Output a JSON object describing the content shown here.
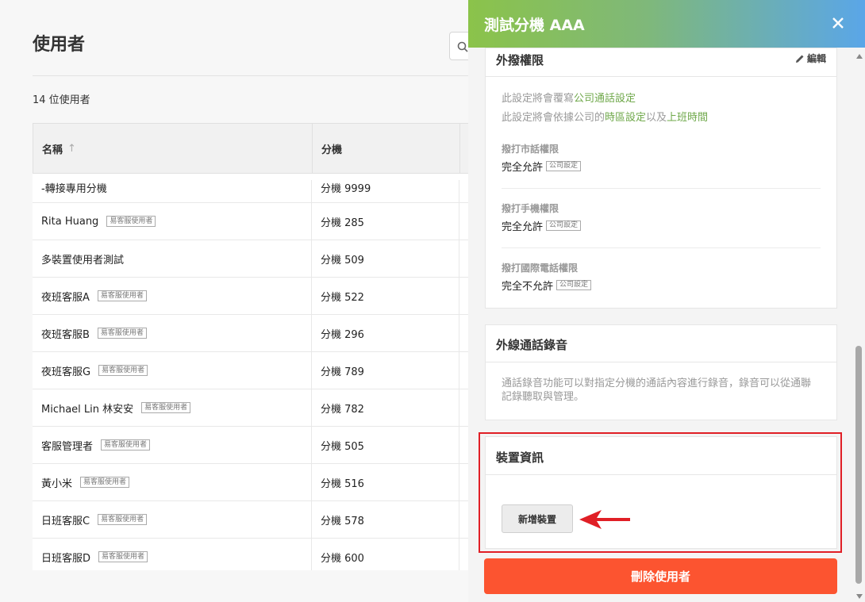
{
  "page": {
    "title": "使用者",
    "user_count": "14 位使用者"
  },
  "table": {
    "columns": [
      "名稱",
      "分機"
    ],
    "sort_indicator": "↑",
    "rows": [
      {
        "name": "-轉接專用分機",
        "tag": "",
        "ext": "分機 9999"
      },
      {
        "name": "Rita Huang",
        "tag": "易客服使用者",
        "ext": "分機 285"
      },
      {
        "name": "多裝置使用者測試",
        "tag": "",
        "ext": "分機 509"
      },
      {
        "name": "夜班客服A",
        "tag": "易客服使用者",
        "ext": "分機 522"
      },
      {
        "name": "夜班客服B",
        "tag": "易客服使用者",
        "ext": "分機 296"
      },
      {
        "name": "夜班客服G",
        "tag": "易客服使用者",
        "ext": "分機 789"
      },
      {
        "name": "Michael Lin 林安安",
        "tag": "易客服使用者",
        "ext": "分機 782"
      },
      {
        "name": "客服管理者",
        "tag": "易客服使用者",
        "ext": "分機 505"
      },
      {
        "name": "黃小米",
        "tag": "易客服使用者",
        "ext": "分機 516"
      },
      {
        "name": "日班客服C",
        "tag": "易客服使用者",
        "ext": "分機 578"
      },
      {
        "name": "日班客服D",
        "tag": "易客服使用者",
        "ext": "分機 600"
      }
    ]
  },
  "drawer": {
    "title": "測試分機 AAA",
    "close_icon": "close-icon",
    "outbound": {
      "title": "外撥權限",
      "edit_label": "編輯",
      "note1_prefix": "此設定將會覆寫",
      "note1_link": "公司通話設定",
      "note2_prefix": "此設定將會依據公司的",
      "note2_link1": "時區設定",
      "note2_mid": "以及",
      "note2_link2": "上班時間",
      "permissions": [
        {
          "label": "撥打市話權限",
          "value": "完全允許",
          "tag": "公司設定"
        },
        {
          "label": "撥打手機權限",
          "value": "完全允許",
          "tag": "公司設定"
        },
        {
          "label": "撥打國際電話權限",
          "value": "完全不允許",
          "tag": "公司設定"
        }
      ]
    },
    "recording": {
      "title": "外線通話錄音",
      "description": "通話錄音功能可以對指定分機的通話內容進行錄音，錄音可以從通聯記錄聽取與管理。"
    },
    "device": {
      "title": "裝置資訊",
      "add_label": "新增裝置"
    },
    "delete_label": "刪除使用者"
  },
  "colors": {
    "header_gradient_start": "#8bc34a",
    "header_gradient_end": "#5aa6e8",
    "link_green": "#6fa84a",
    "delete_red": "#fc5430",
    "highlight_red": "#e01f26"
  }
}
